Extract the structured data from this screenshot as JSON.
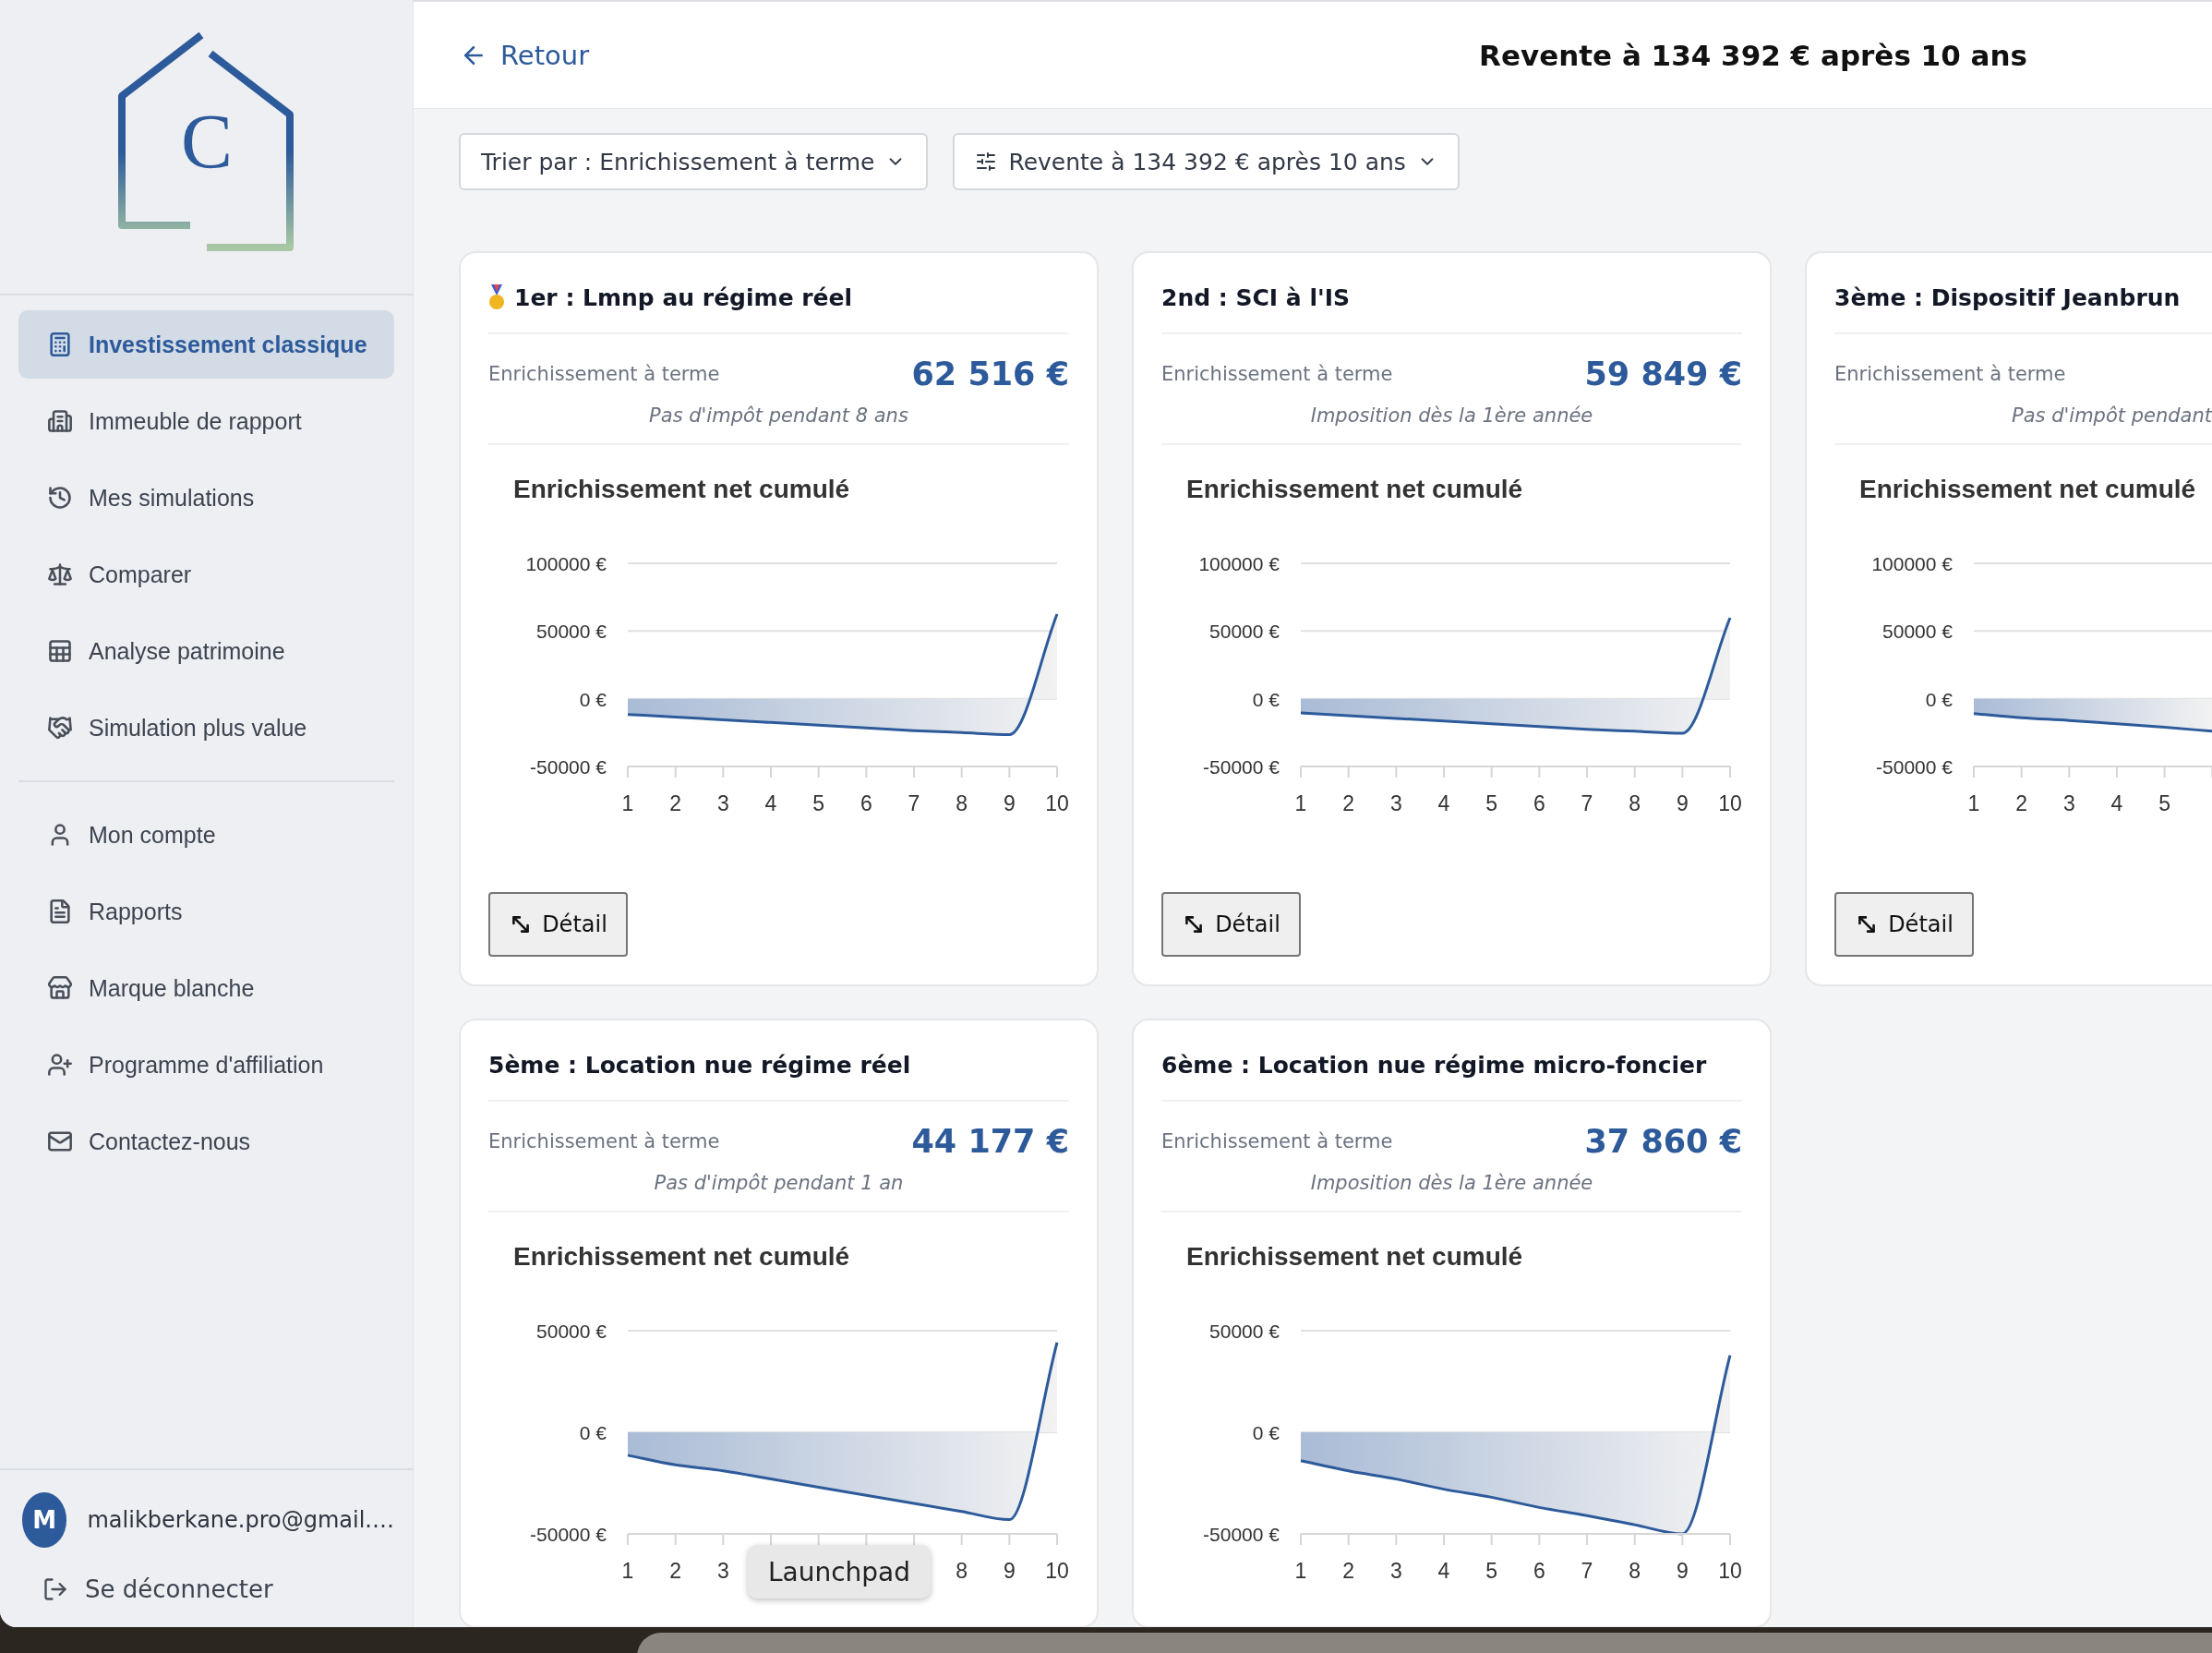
{
  "header": {
    "back_link": "Retour",
    "title": "Revente à 134 392 € après 10 ans"
  },
  "filters": [
    {
      "kind": "sort",
      "label": "Trier par : Enrichissement à terme"
    },
    {
      "kind": "settings",
      "label": "Revente à 134 392 € après 10 ans"
    }
  ],
  "sidebar": {
    "logo_letter": "C",
    "main_items": [
      {
        "label": "Investissement classique",
        "selected": true
      },
      {
        "label": "Immeuble de rapport",
        "selected": false
      },
      {
        "label": "Mes simulations",
        "selected": false
      },
      {
        "label": "Comparer",
        "selected": false
      },
      {
        "label": "Analyse patrimoine",
        "selected": false
      },
      {
        "label": "Simulation plus value",
        "selected": false
      }
    ],
    "account_items": [
      {
        "label": "Mon compte",
        "selected": false
      },
      {
        "label": "Rapports",
        "selected": false
      },
      {
        "label": "Marque blanche",
        "selected": false
      },
      {
        "label": "Programme d'affiliation",
        "selected": false
      },
      {
        "label": "Contactez-nous",
        "selected": false
      }
    ],
    "user": {
      "initial": "M",
      "email": "malikberkane.pro@gmail.…"
    },
    "logout": "Se déconnecter"
  },
  "cards": [
    {
      "title": "1er : Lmnp au régime réel",
      "metric_label": "Enrichissement à terme",
      "metric_value": "62 516 €",
      "note": "Pas d'impôt pendant 8 ans",
      "detail_button": "Détail",
      "chart_data": {
        "type": "area",
        "title": "Enrichissement net cumulé",
        "x": [
          1,
          2,
          3,
          4,
          5,
          6,
          7,
          8,
          9,
          10
        ],
        "xlim": [
          1,
          10
        ],
        "ylim": [
          -50000,
          100000
        ],
        "yticks": [
          {
            "value": 100000,
            "label": "100000 €"
          },
          {
            "value": 50000,
            "label": "50000 €"
          },
          {
            "value": 0,
            "label": "0 €"
          },
          {
            "value": -50000,
            "label": "-50000 €"
          }
        ],
        "xticks": [
          1,
          2,
          3,
          4,
          5,
          6,
          7,
          8,
          9,
          10
        ],
        "series": [
          {
            "color": "#2d5a9a",
            "values": [
              -11600,
              -13500,
              -15500,
              -17500,
              -19500,
              -21500,
              -23500,
              -25000,
              -26500,
              62500
            ]
          }
        ]
      }
    },
    {
      "title": "2nd : SCI à l'IS",
      "metric_label": "Enrichissement à terme",
      "metric_value": "59 849 €",
      "note": "Imposition dès la 1ère année",
      "detail_button": "Détail",
      "chart_data": {
        "type": "area",
        "title": "Enrichissement net cumulé",
        "x": [
          1,
          2,
          3,
          4,
          5,
          6,
          7,
          8,
          9,
          10
        ],
        "xlim": [
          1,
          10
        ],
        "ylim": [
          -50000,
          100000
        ],
        "yticks": [
          {
            "value": 100000,
            "label": "100000 €"
          },
          {
            "value": 50000,
            "label": "50000 €"
          },
          {
            "value": 0,
            "label": "0 €"
          },
          {
            "value": -50000,
            "label": "-50000 €"
          }
        ],
        "xticks": [
          1,
          2,
          3,
          4,
          5,
          6,
          7,
          8,
          9,
          10
        ],
        "series": [
          {
            "color": "#2d5a9a",
            "values": [
              -10500,
              -12500,
              -14500,
              -16500,
              -18500,
              -20500,
              -22500,
              -24000,
              -25500,
              59800
            ]
          }
        ]
      }
    },
    {
      "title": "3ème : Dispositif Jeanbrun",
      "metric_label": "Enrichissement à terme",
      "note": "Pas d'impôt pendant",
      "detail_button": "Détail",
      "chart_data": {
        "type": "area",
        "title": "Enrichissement net cumulé",
        "x": [
          1,
          2,
          3,
          4,
          5,
          6
        ],
        "xlim": [
          1,
          6
        ],
        "ylim": [
          -50000,
          100000
        ],
        "yticks": [
          {
            "value": 100000,
            "label": "100000 €"
          },
          {
            "value": 50000,
            "label": "50000 €"
          },
          {
            "value": 0,
            "label": "0 €"
          },
          {
            "value": -50000,
            "label": "-50000 €"
          }
        ],
        "xticks": [
          1,
          2,
          3,
          4,
          5
        ],
        "series": [
          {
            "color": "#2d5a9a",
            "values": [
              -11000,
              -14000,
              -16000,
              -18500,
              -21000,
              -24000
            ]
          }
        ]
      }
    },
    {
      "title": "5ème : Location nue régime réel",
      "metric_label": "Enrichissement à terme",
      "metric_value": "44 177 €",
      "note": "Pas d'impôt pendant 1 an",
      "chart_data": {
        "type": "area",
        "title": "Enrichissement net cumulé",
        "x": [
          1,
          2,
          3,
          4,
          5,
          6,
          7,
          8,
          9,
          10
        ],
        "xlim": [
          1,
          10
        ],
        "ylim": [
          -50000,
          50000
        ],
        "yticks": [
          {
            "value": 50000,
            "label": "50000 €"
          },
          {
            "value": 0,
            "label": "0 €"
          },
          {
            "value": -50000,
            "label": "-50000 €"
          }
        ],
        "xticks": [
          1,
          2,
          3,
          8,
          9,
          10
        ],
        "series": [
          {
            "color": "#2d5a9a",
            "values": [
              -11300,
              -16000,
              -19000,
              -23000,
              -27000,
              -31000,
              -35000,
              -39000,
              -43000,
              44200
            ]
          }
        ]
      }
    },
    {
      "title": "6ème : Location nue régime micro-foncier",
      "metric_label": "Enrichissement à terme",
      "metric_value": "37 860 €",
      "note": "Imposition dès la 1ère année",
      "chart_data": {
        "type": "area",
        "title": "Enrichissement net cumulé",
        "x": [
          1,
          2,
          3,
          4,
          5,
          6,
          7,
          8,
          9,
          10
        ],
        "xlim": [
          1,
          10
        ],
        "ylim": [
          -50000,
          50000
        ],
        "yticks": [
          {
            "value": 50000,
            "label": "50000 €"
          },
          {
            "value": 0,
            "label": "0 €"
          },
          {
            "value": -50000,
            "label": "-50000 €"
          }
        ],
        "xticks": [
          1,
          2,
          3,
          4,
          5,
          6,
          7,
          8,
          9,
          10
        ],
        "series": [
          {
            "color": "#2d5a9a",
            "values": [
              -14000,
              -19000,
              -23000,
              -28000,
              -32000,
              -37000,
              -41000,
              -45500,
              -50000,
              37900
            ]
          }
        ]
      }
    }
  ],
  "tooltip": "Launchpad"
}
